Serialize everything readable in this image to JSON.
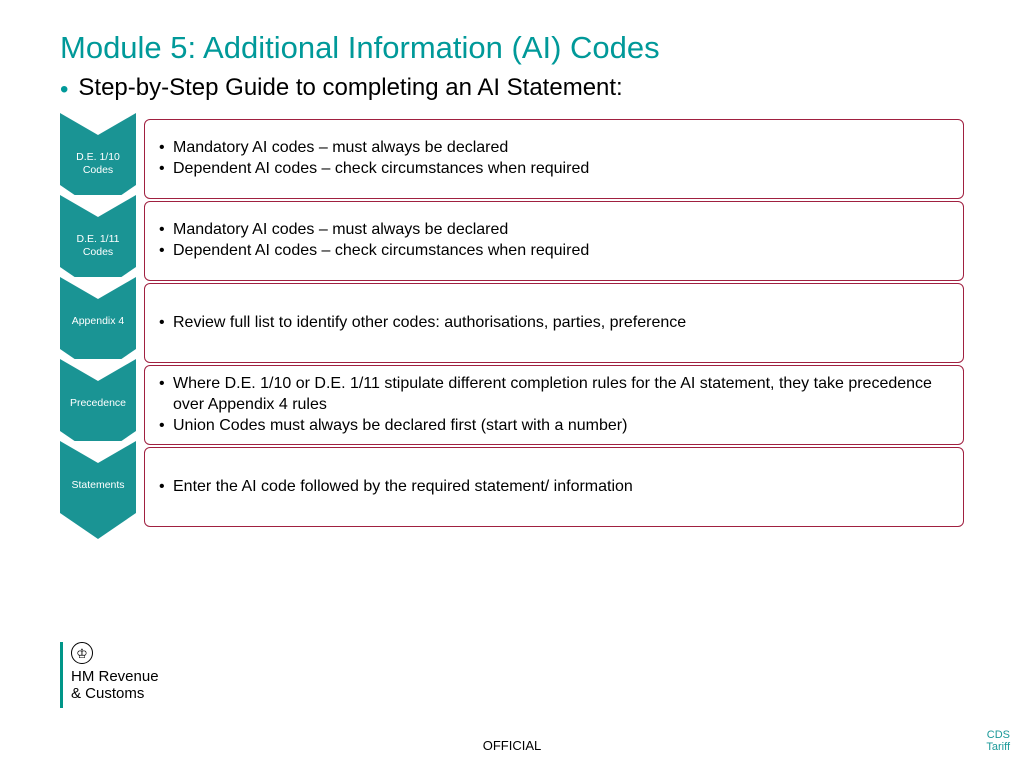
{
  "title": "Module 5: Additional Information (AI) Codes",
  "subtitle": "Step-by-Step Guide to completing an AI Statement:",
  "steps": [
    {
      "label": "D.E. 1/10 Codes",
      "items": [
        "Mandatory AI codes – must always be declared",
        "Dependent AI codes – check circumstances when required"
      ]
    },
    {
      "label": "D.E. 1/11 Codes",
      "items": [
        "Mandatory AI codes – must always be declared",
        "Dependent AI codes – check circumstances when required"
      ]
    },
    {
      "label": "Appendix 4",
      "items": [
        "Review full list to identify other codes: authorisations, parties, preference"
      ]
    },
    {
      "label": "Precedence",
      "items": [
        "Where D.E. 1/10 or D.E. 1/11 stipulate different completion rules for the AI statement, they take precedence over Appendix 4 rules",
        "Union Codes must always be declared first (start with a number)"
      ]
    },
    {
      "label": "Statements",
      "items": [
        "Enter the AI code followed by the required statement/ information"
      ]
    }
  ],
  "logo": {
    "line1": "HM Revenue",
    "line2": "& Customs"
  },
  "footer_center": "OFFICIAL",
  "footer_right": "CDS Tariff"
}
